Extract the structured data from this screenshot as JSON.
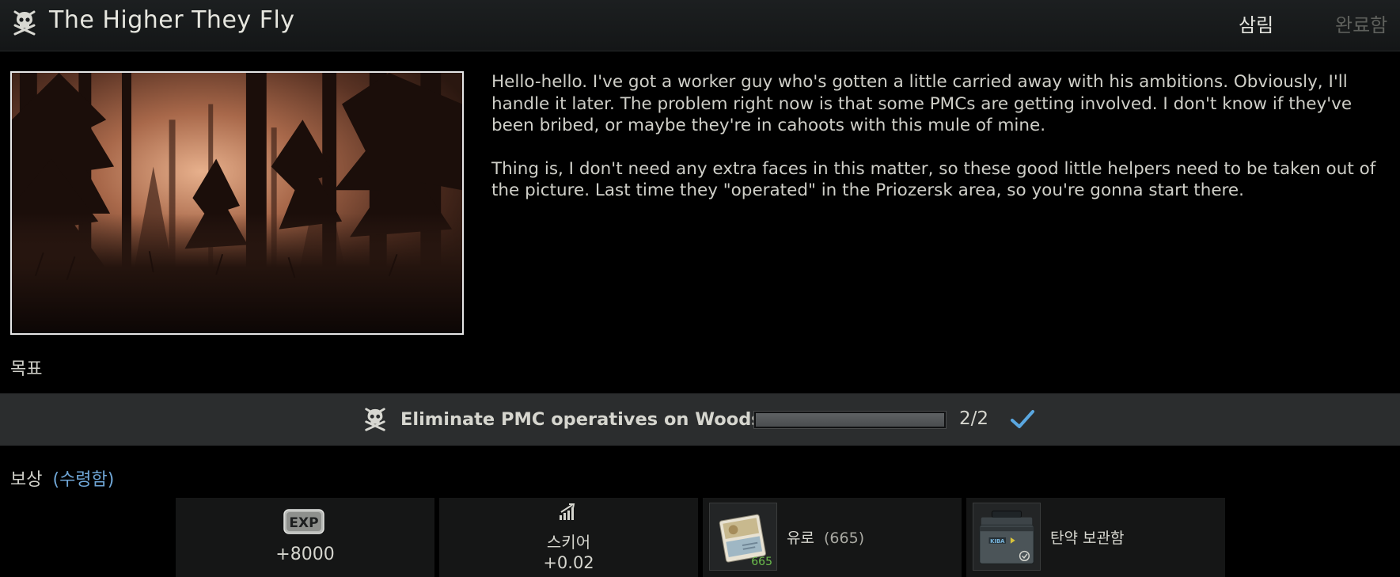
{
  "header": {
    "icon": "skull-crossbones-icon",
    "title": "The Higher They Fly",
    "location": "삼림",
    "status": "완료함"
  },
  "image": {
    "scene": "dark pine forest at dusk"
  },
  "description": {
    "paragraphs": [
      "Hello-hello. I've got a worker guy who's gotten a little carried away with his ambitions. Obviously, I'll handle it later. The problem right now is that some PMCs are getting involved. I don't know if they've been bribed, or maybe they're in cahoots with this mule of mine.",
      "Thing is, I don't need any extra faces in this matter, so these good little helpers need to be taken out of the picture. Last time they \"operated\" in the Priozersk area, so you're gonna start there."
    ]
  },
  "objectives": {
    "label": "목표",
    "items": [
      {
        "icon": "skull-crossbones-icon",
        "text": "Eliminate PMC operatives on Woods",
        "progress_fraction": 1.0,
        "count": "2/2",
        "completed_icon": "checkmark-icon"
      }
    ]
  },
  "rewards": {
    "label": "보상",
    "received": "(수령함)",
    "items": [
      {
        "type": "exp",
        "icon": "exp-badge-icon",
        "badge_text": "EXP",
        "value": "+8000"
      },
      {
        "type": "standing",
        "icon": "signal-bars-icon",
        "name": "스키어",
        "value": "+0.02"
      },
      {
        "type": "item",
        "icon": "euro-banknotes-icon",
        "name": "유로",
        "amount": "(665)",
        "count": "665"
      },
      {
        "type": "item",
        "icon": "ammo-case-icon",
        "name": "탄약 보관함",
        "brand": "KIBA"
      }
    ]
  },
  "colors": {
    "accent_blue": "#6fa6d6",
    "count_green": "#6cbf4d",
    "header_bg": "#1c1f20",
    "objective_bg": "#2b2d2e"
  }
}
